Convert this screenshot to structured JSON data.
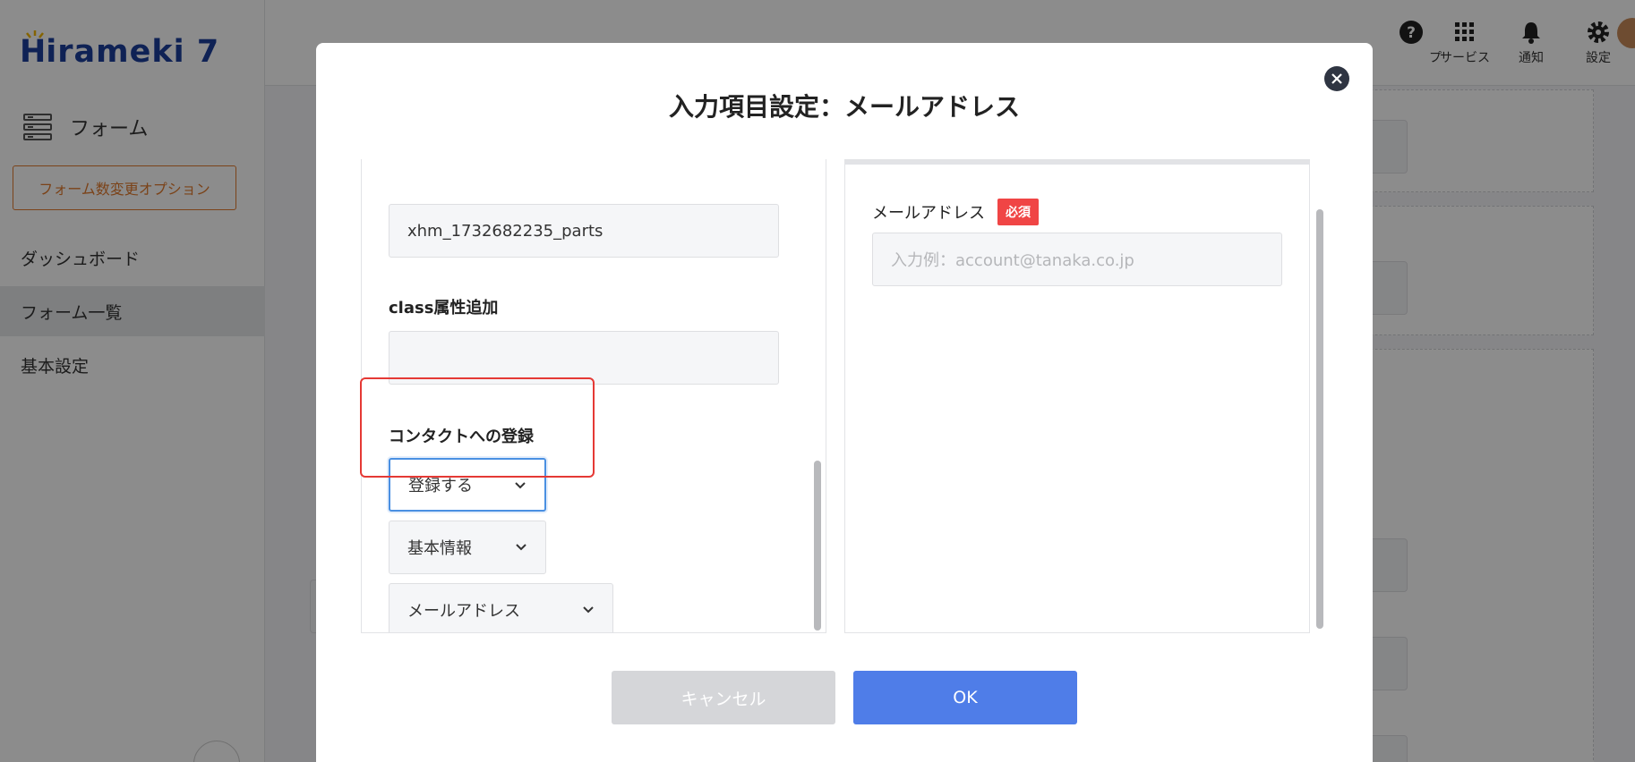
{
  "app": {
    "logo": "irameki 7",
    "nav_form_label": "フォーム",
    "option_button": "フォーム数変更オプション",
    "sidebar": [
      {
        "label": "ダッシュボード"
      },
      {
        "label": "フォーム一覧"
      },
      {
        "label": "基本設定"
      }
    ],
    "topbar": [
      {
        "label": "プ",
        "icon": "help-icon"
      },
      {
        "label": "サービス",
        "icon": "grid-icon"
      },
      {
        "label": "通知",
        "icon": "bell-icon"
      },
      {
        "label": "設定",
        "icon": "gear-icon"
      }
    ]
  },
  "modal": {
    "title": "入力項目設定：メールアドレス",
    "left": {
      "name_value": "xhm_1732682235_parts",
      "class_label": "class属性追加",
      "class_value": "",
      "contact_label": "コンタクトへの登録",
      "contact_select": "登録する",
      "category_select": "基本情報",
      "field_select": "メールアドレス"
    },
    "right": {
      "preview_label": "メールアドレス",
      "required_badge": "必須",
      "preview_placeholder": "入力例：account@tanaka.co.jp"
    },
    "cancel_label": "キャンセル",
    "ok_label": "OK"
  },
  "colors": {
    "accent": "#4f7de8",
    "brand": "#1d3f9c",
    "option": "#e07a2e",
    "required": "#f04545",
    "highlight": "#e53935"
  }
}
